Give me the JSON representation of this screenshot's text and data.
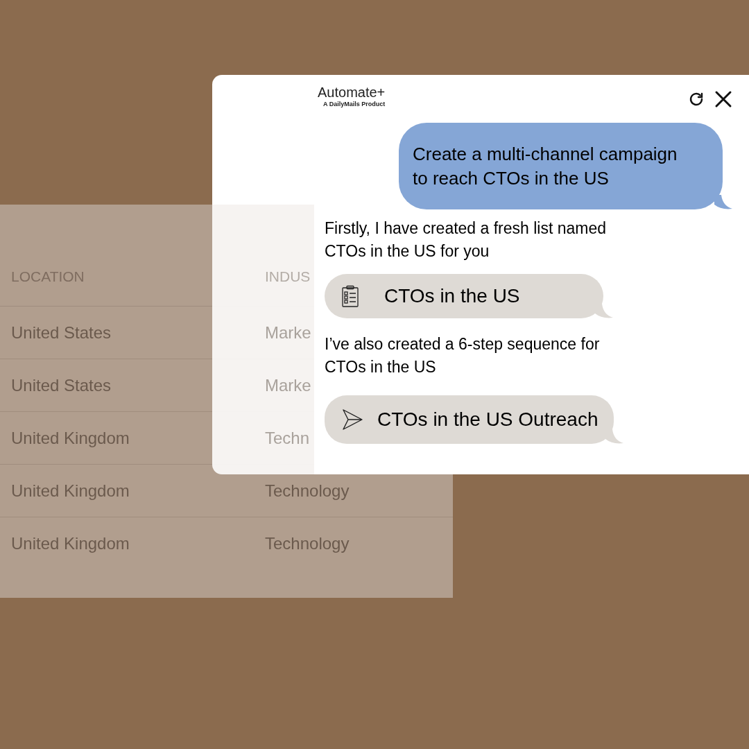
{
  "table": {
    "columns": [
      "LOCATION",
      "INDUS"
    ],
    "rows": [
      [
        "United States",
        "Marke"
      ],
      [
        "United States",
        "Marke"
      ],
      [
        "United Kingdom",
        "Techn"
      ],
      [
        "United Kingdom",
        "Technology"
      ],
      [
        "United Kingdom",
        "Technology"
      ]
    ]
  },
  "chat": {
    "logo": {
      "name": "Automate+",
      "tagline": "A DailyMails Product"
    },
    "messages": [
      {
        "kind": "user",
        "text": "Create a multi-channel campaign to reach CTOs in the US"
      },
      {
        "kind": "bot",
        "text": "Firstly, I have created a fresh list named CTOs in the US for you"
      },
      {
        "kind": "list",
        "text": "CTOs in the US"
      },
      {
        "kind": "bot",
        "text": "I’ve also created a 6-step sequence for CTOs in the US"
      },
      {
        "kind": "sequence",
        "text": "CTOs in the US Outreach"
      }
    ]
  }
}
